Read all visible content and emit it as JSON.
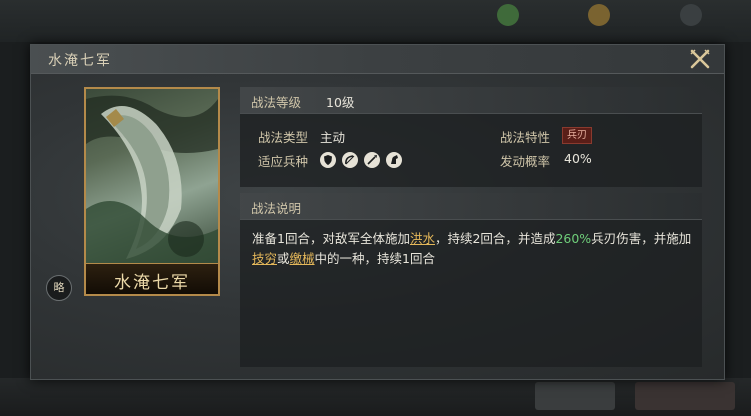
{
  "dialog": {
    "title": "水淹七军",
    "card_name": "水淹七军",
    "strategy_button_label": "略"
  },
  "level": {
    "label": "战法等级",
    "value": "10级"
  },
  "attributes": {
    "type_label": "战法类型",
    "type_value": "主动",
    "trait_label": "战法特性",
    "trait_value": "兵刃",
    "troops_label": "适应兵种",
    "troop_icons": [
      "shield-icon",
      "bow-icon",
      "spear-icon",
      "horse-icon"
    ],
    "prob_label": "发动概率",
    "prob_value": "40%"
  },
  "description": {
    "title": "战法说明",
    "t1": "准备1回合，对敌军全体施加",
    "flood": "洪水",
    "t2": "，持续2回合，并造成",
    "percent": "260%",
    "t3": "兵刃伤害，并施加",
    "exhaust": "技穷",
    "t4": "或",
    "disarm": "缴械",
    "t5": "中的一种，持续1回合"
  },
  "colors": {
    "gold_accent": "#e5b85a",
    "green_accent": "#6fce7a",
    "card_border": "#b48a4a",
    "trait_tag_bg": "#5a1e18"
  }
}
